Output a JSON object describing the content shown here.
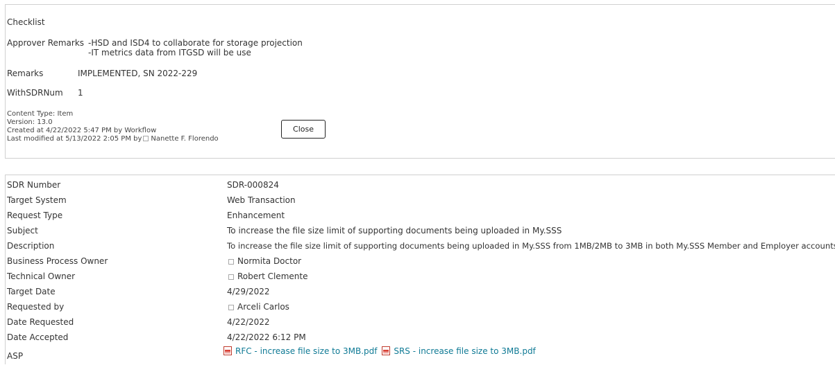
{
  "details": {
    "checklist_label": "Checklist",
    "approver_remarks_label": "Approver Remarks",
    "approver_remarks_lines": [
      "-HSD and ISD4 to collaborate for storage projection",
      "-IT metrics data from ITGSD will be use"
    ],
    "remarks_label": "Remarks",
    "remarks_value": "IMPLEMENTED, SN 2022-229",
    "withsdrnum_label": "WithSDRNum",
    "withsdrnum_value": "1",
    "content_type": "Content Type: Item",
    "version": "Version: 13.0",
    "created": "Created at 4/22/2022 5:47 PM  by Workflow",
    "modified_prefix": "Last modified at 5/13/2022 2:05 PM  by",
    "modified_by": "Nanette F. Florendo",
    "close_label": "Close"
  },
  "record": {
    "sdr_number_label": "SDR Number",
    "sdr_number": "SDR-000824",
    "target_system_label": "Target System",
    "target_system": "Web Transaction",
    "request_type_label": "Request Type",
    "request_type": "Enhancement",
    "subject_label": "Subject",
    "subject": "To increase the file size limit of supporting documents being uploaded in My.SSS",
    "description_label": "Description",
    "description": "To increase the file size limit of supporting documents being uploaded in My.SSS from 1MB/2MB to 3MB in both My.SSS Member and Employer accounts.",
    "bpo_label": "Business Process Owner",
    "bpo": "Normita Doctor",
    "tech_owner_label": "Technical Owner",
    "tech_owner": "Robert Clemente",
    "target_date_label": "Target Date",
    "target_date": "4/29/2022",
    "requested_by_label": "Requested by",
    "requested_by": "Arceli Carlos",
    "date_requested_label": "Date Requested",
    "date_requested": "4/22/2022",
    "date_accepted_label": "Date Accepted",
    "date_accepted": "4/22/2022 6:12 PM",
    "asp_label": "ASP",
    "attachments": [
      "RFC - increase file size to 3MB.pdf",
      "SRS - increase file size to 3MB.pdf"
    ]
  },
  "icons": {
    "presence": "presence-box-icon",
    "pdf": "pdf-file-icon"
  }
}
